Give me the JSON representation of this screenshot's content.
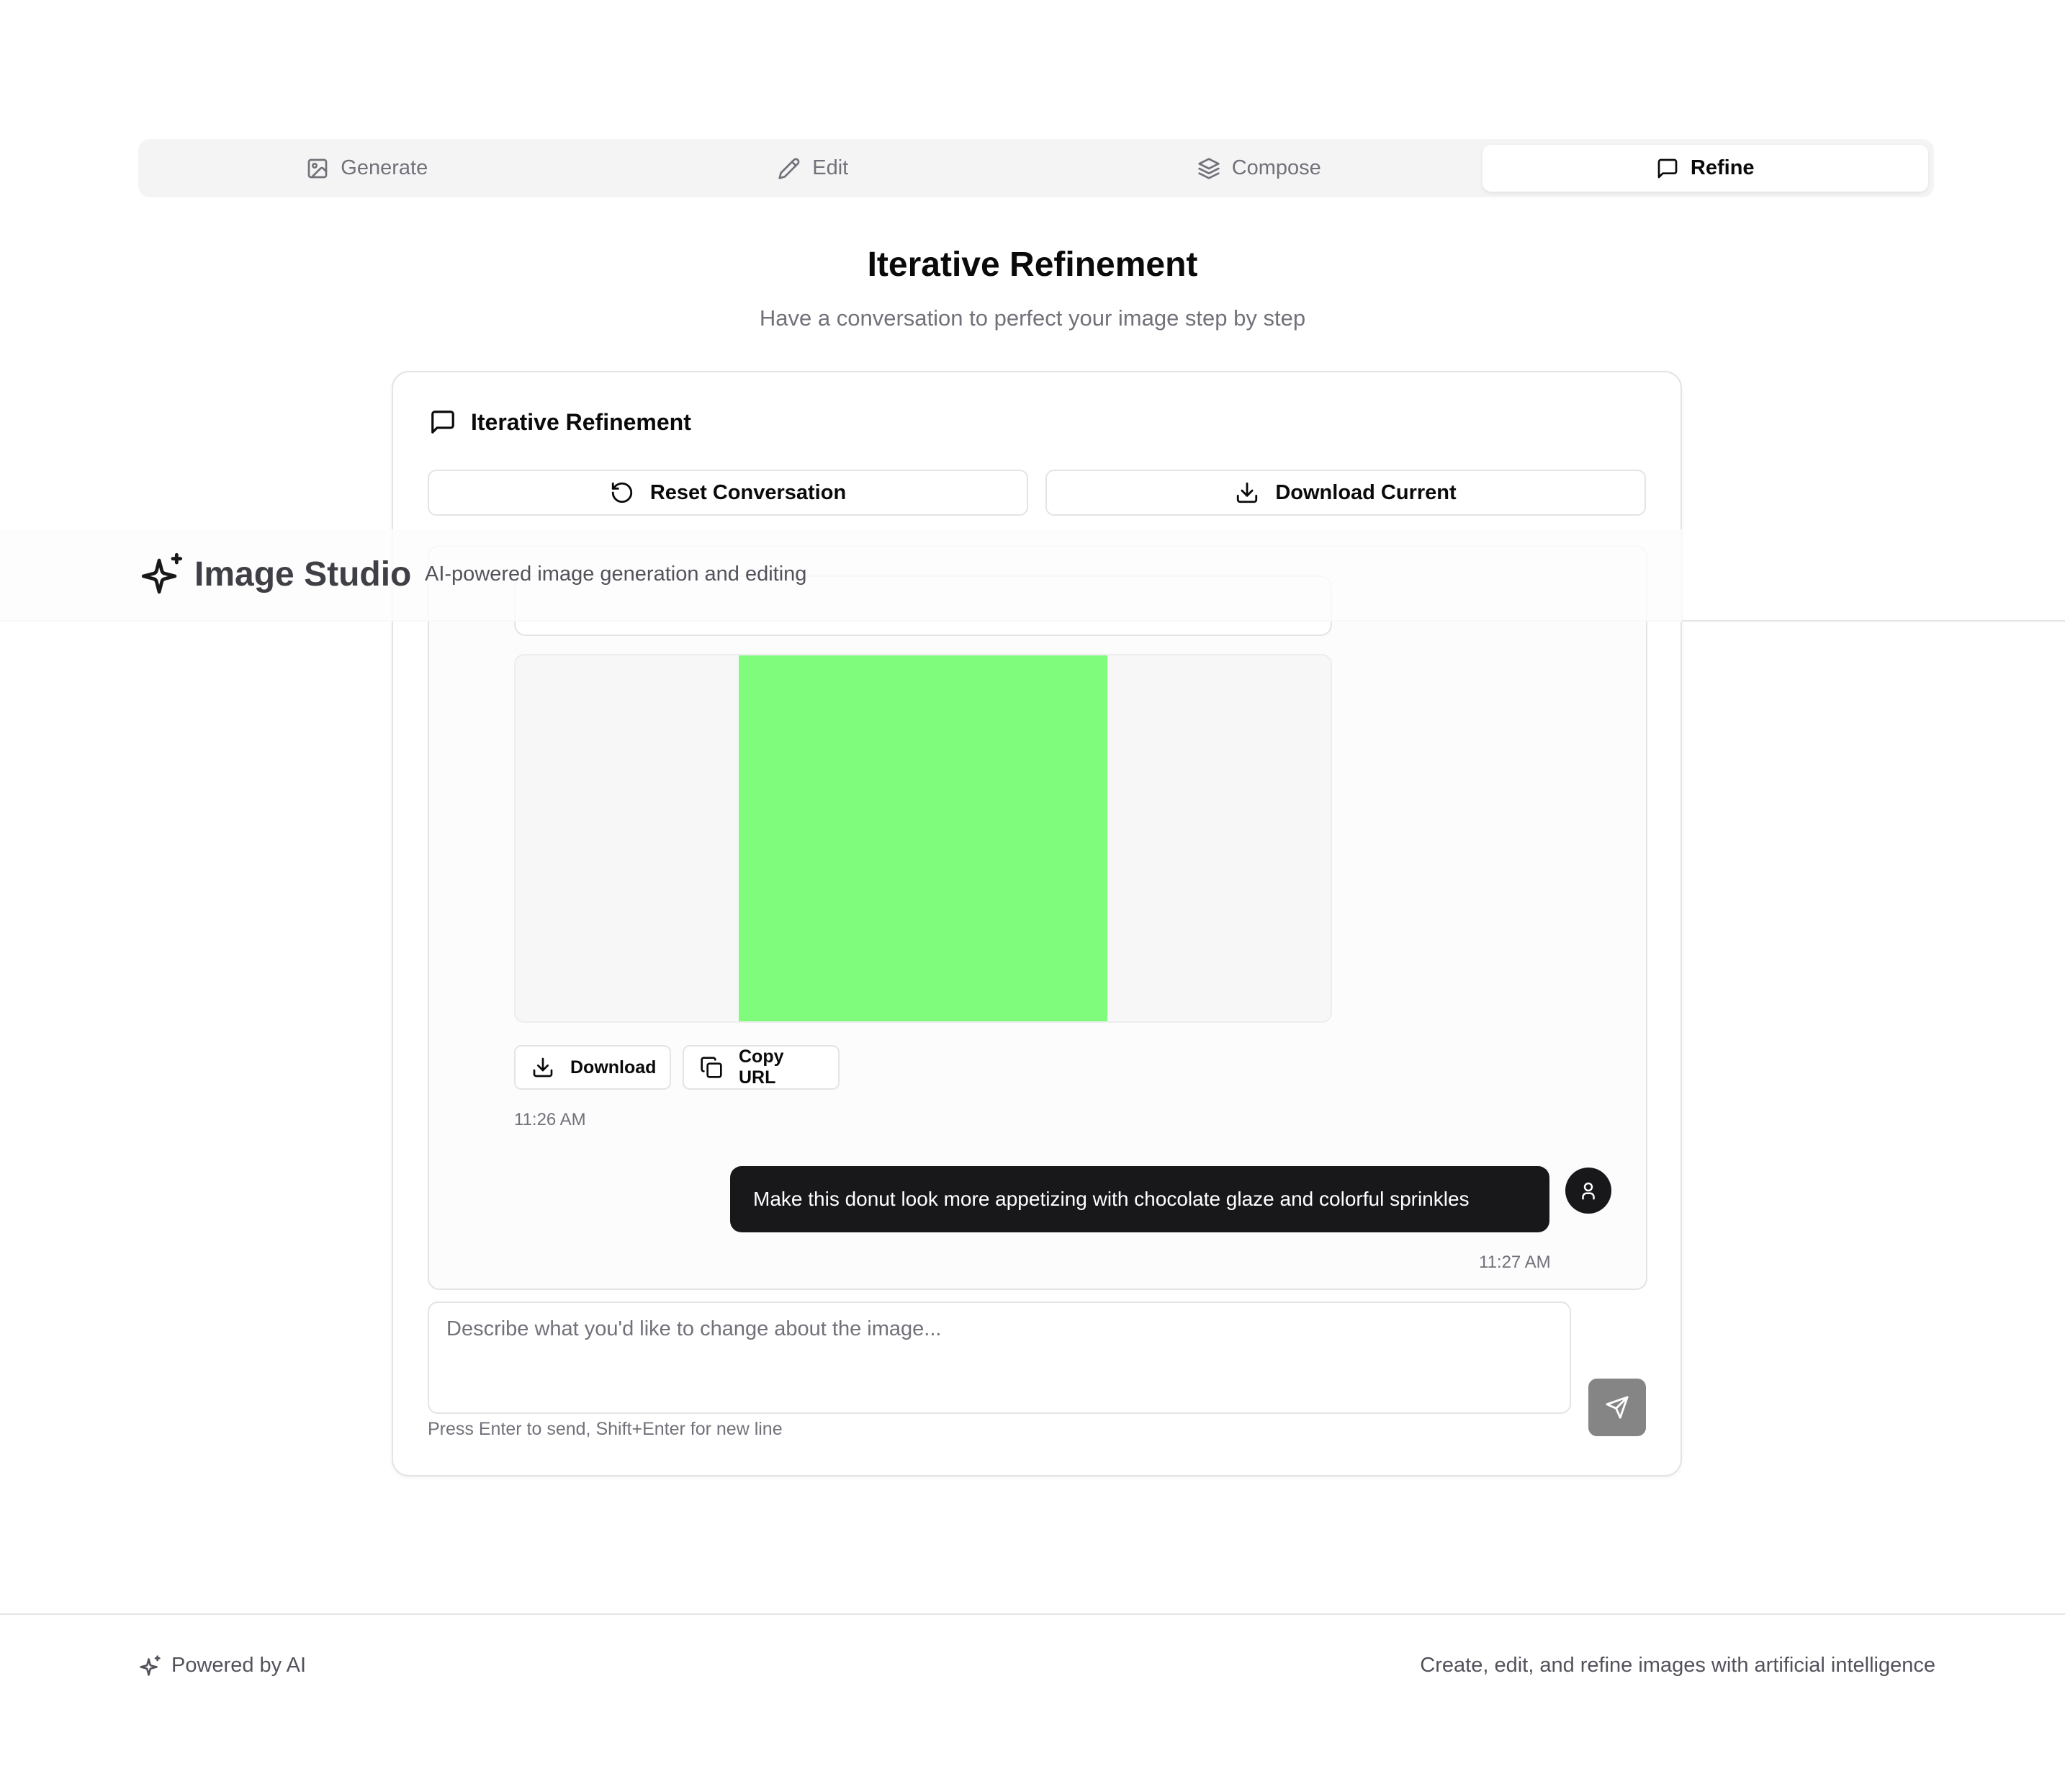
{
  "tabs": [
    {
      "label": "Generate",
      "icon": "image-icon",
      "active": false
    },
    {
      "label": "Edit",
      "icon": "pencil-icon",
      "active": false
    },
    {
      "label": "Compose",
      "icon": "layers-icon",
      "active": false
    },
    {
      "label": "Refine",
      "icon": "message-square-icon",
      "active": true
    }
  ],
  "page": {
    "title": "Iterative Refinement",
    "subtitle": "Have a conversation to perfect your image step by step"
  },
  "card": {
    "title": "Iterative Refinement",
    "reset_label": "Reset Conversation",
    "download_current_label": "Download Current"
  },
  "conversation": {
    "ai_message": {
      "image_color": "#80fc7c",
      "download_label": "Download",
      "copy_url_label": "Copy URL",
      "timestamp": "11:26 AM"
    },
    "user_message": {
      "text": "Make this donut look more appetizing with chocolate glaze and colorful sprinkles",
      "timestamp": "11:27 AM"
    }
  },
  "input": {
    "placeholder": "Describe what you'd like to change about the image...",
    "value": "",
    "hint": "Press Enter to send, Shift+Enter for new line"
  },
  "header": {
    "brand": "Image Studio",
    "tagline": "AI-powered image generation and editing"
  },
  "footer": {
    "left": "Powered by AI",
    "right": "Create, edit, and refine images with artificial intelligence"
  },
  "colors": {
    "accent_dark": "#18181b",
    "muted_text": "#71717a",
    "border": "#e4e4e7",
    "send_button": "#858585"
  }
}
